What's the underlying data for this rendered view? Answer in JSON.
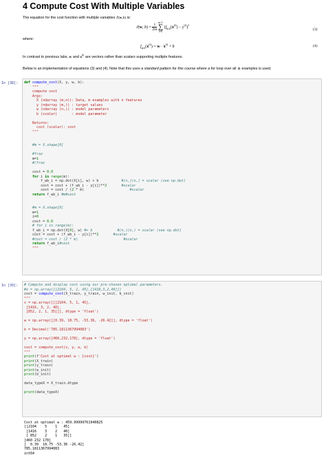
{
  "heading": "4 Compute Cost With Multiple Variables",
  "intro": "The equation for the cost function with multiple variables",
  "intro_is": "is:",
  "where": "where:",
  "eq3": {
    "lhs": "J(w,b) =",
    "frac_num": "1",
    "frac_den": "2m",
    "sum_top": "m-1",
    "sum_bottom": "i=0",
    "body": "(f",
    "sub": "w,b",
    "body2": "(x",
    "sup": "(i)",
    "body3": ") − y",
    "body4": ")",
    "sq": "2",
    "num": "(3)"
  },
  "eq4": {
    "lhs": "f",
    "sub": "w,b",
    "lhs2": "(x",
    "sup": "(i)",
    "rhs": ") = w · x",
    "sup2": "(i)",
    "rhs2": " + b",
    "num": "(4)"
  },
  "contrast": {
    "pre": "In contrast to previous labs,",
    "w": "w",
    "and": "and",
    "x": "x",
    "sup": "(i)",
    "post": "are vectors rather than scalars supporting multiple features."
  },
  "below": {
    "pre": "Below is an implementation of equations (3) and (4). Note that this uses a",
    "italic": "standard pattern for this course",
    "mid": "where a for loop over all",
    "code": "m",
    "post": "examples is used."
  },
  "cell38": {
    "prompt": "In [38]:",
    "lines": [
      "def compute_cost(X, y, w, b):",
      "    \"\"\"",
      "    compute cost",
      "    Args:",
      "      X (ndarray (m,n)): Data, m examples with n features",
      "      y (ndarray (m,)) : target values",
      "      w (ndarray (n,)) : model parameters",
      "      b (scalar)       : model parameter",
      "",
      "    Returns:",
      "      cost (scalar): cost",
      "    \"\"\"",
      "",
      "",
      "    #m = X.shape[0]",
      "",
      "    #fraz",
      "    m=1",
      "    #/fraz",
      "",
      "    cost = 0.0",
      "    for i in range(m):",
      "        f_wb_i = np.dot(X[i], w) + b           #(n,)(n,) = scalar (see np.dot)",
      "        cost = cost + (f_wb_i - y[i])**2       #scalar",
      "        cost = cost / (2 * m)                      #scalar",
      "    return f_wb_i #m#cost",
      "",
      "",
      "    #m = X.shape[0]",
      "    m=1",
      "    i=0",
      "    cost = 0.0",
      "    # for i in range(m):",
      "    f_wb_i = np.dot(X[0], w) #+ b            #(n,)(n,) = scalar (see np.dot)",
      "    cost = cost + (f_wb_i - y[i])**2       #scalar",
      "    #cost = cost / (2 * m)                      #scalar",
      "    return f_wb_i#cost",
      "    \"\"\""
    ]
  },
  "cell39": {
    "prompt": "In [39]:",
    "lines": [
      "# Compute and display cost using our pre-chosen optimal parameters.",
      "#x = np.array([[2104, 5, 1, 45],[1416,3,2,40]])",
      "cost = compute_cost(X_train, y_train, w_init, b_init)",
      "\"\"\"",
      "x = np.array([[[2104, 5, 1, 45],",
      " [1416, 3, 2, 40],",
      " [852, 2, 1, 35]]], dtype = 'float')",
      "",
      "w = np.array([[0.39, 18.75, -53.36, -26.42]], dtype = 'float')",
      "",
      "b = Decimal('785.1811367994083')",
      "",
      "y = np.array([460,232,178], dtype = 'float')",
      "",
      "cost = compute_cost(x, y, w, b)",
      "\"\"\"",
      "print(f'Cost at optimal w : {cost}')",
      "print(X_train)",
      "print(y_train)",
      "print(w_init)",
      "print(b_init)",
      "",
      "data_typeX = X_train.dtype",
      "",
      "print(data_typeX)"
    ],
    "output": [
      "Cost at optimal w : 459.99999761940825",
      "[[2104    5    1   45]",
      " [1416    3    2   40]",
      " [ 852    2    1   35]]",
      "[460 232 178]",
      "[  0.39  18.75 -53.36 -26.42]",
      "785.1811367994083",
      "int64"
    ]
  }
}
